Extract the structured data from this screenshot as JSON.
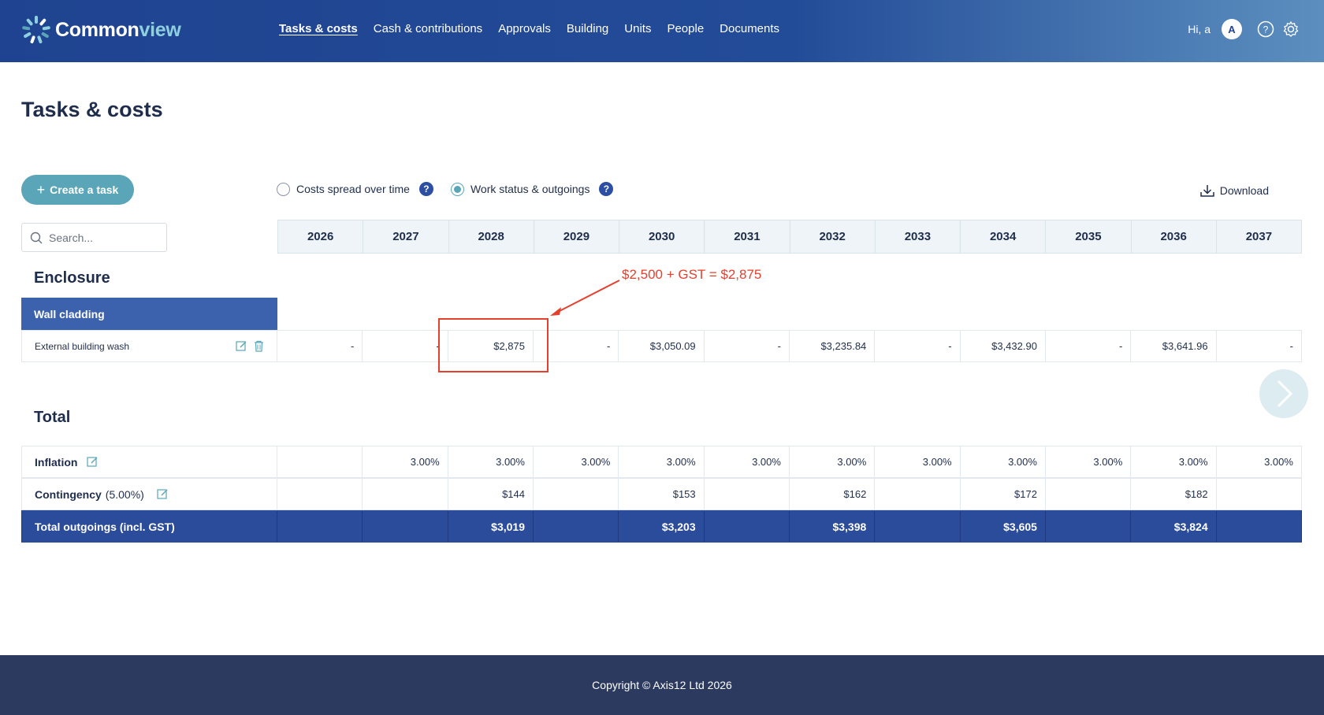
{
  "brand": {
    "name_main": "Common",
    "name_accent": "view"
  },
  "nav": [
    {
      "label": "Tasks & costs",
      "active": true
    },
    {
      "label": "Cash & contributions"
    },
    {
      "label": "Approvals"
    },
    {
      "label": "Building"
    },
    {
      "label": "Units"
    },
    {
      "label": "People"
    },
    {
      "label": "Documents"
    }
  ],
  "user": {
    "greeting": "Hi, a",
    "avatar_initial": "A"
  },
  "page": {
    "title": "Tasks & costs"
  },
  "toolbar": {
    "create_label": "Create a task",
    "view_options": [
      {
        "label": "Costs spread over time",
        "selected": false
      },
      {
        "label": "Work status & outgoings",
        "selected": true
      }
    ],
    "help_glyph": "?",
    "download_label": "Download"
  },
  "search": {
    "placeholder": "Search..."
  },
  "years": [
    "2026",
    "2027",
    "2028",
    "2029",
    "2030",
    "2031",
    "2032",
    "2033",
    "2034",
    "2035",
    "2036",
    "2037"
  ],
  "sections": {
    "enclosure": {
      "title": "Enclosure",
      "category": "Wall cladding",
      "task": {
        "name": "External building wash",
        "values": [
          "-",
          "-",
          "$2,875",
          "-",
          "$3,050.09",
          "-",
          "$3,235.84",
          "-",
          "$3,432.90",
          "-",
          "$3,641.96",
          "-"
        ]
      }
    },
    "total": {
      "title": "Total",
      "inflation": {
        "label": "Inflation",
        "values": [
          "",
          "3.00%",
          "3.00%",
          "3.00%",
          "3.00%",
          "3.00%",
          "3.00%",
          "3.00%",
          "3.00%",
          "3.00%",
          "3.00%",
          "3.00%"
        ]
      },
      "contingency": {
        "label": "Contingency",
        "rate": "(5.00%)",
        "values": [
          "",
          "",
          "$144",
          "",
          "$153",
          "",
          "$162",
          "",
          "$172",
          "",
          "$182",
          ""
        ]
      },
      "grand": {
        "label": "Total outgoings (incl. GST)",
        "values": [
          "",
          "",
          "$3,019",
          "",
          "$3,203",
          "",
          "$3,398",
          "",
          "$3,605",
          "",
          "$3,824",
          ""
        ]
      }
    }
  },
  "annotation": {
    "text": "$2,500 + GST = $2,875",
    "color": "#e3412e"
  },
  "footer": {
    "copyright": "Copyright © Axis12 Ltd 2026"
  },
  "colors": {
    "header": "#1f4390",
    "accent": "#5aa6b8",
    "band": "#3d62ad",
    "total": "#2b4b9b",
    "footer": "#2c3a60"
  }
}
